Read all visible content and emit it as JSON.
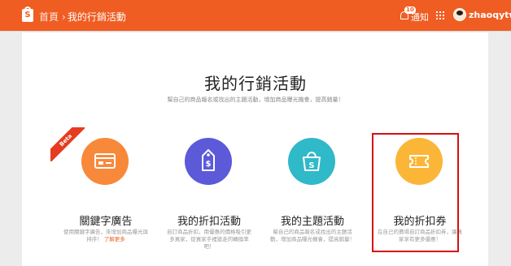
{
  "header": {
    "logo_letter": "S",
    "breadcrumb_home": "首頁",
    "breadcrumb_sep": "›",
    "breadcrumb_current": "我的行銷活動",
    "notification_count": "10",
    "notification_label": "通知",
    "username": "zhaoqytw",
    "color": "#f05d22"
  },
  "main": {
    "title": "我的行銷活動",
    "subtitle": "幫自己的商品報名或找出的主題活動，增加商品曝光機會，提高銷量！"
  },
  "cards": [
    {
      "title": "關鍵字廣告",
      "desc": "使用關鍵字廣告，來增加商品曝光與排序！",
      "link": "了解更多",
      "badge": "Beta",
      "icon": "keyword-ad-icon"
    },
    {
      "title": "我的折扣活動",
      "desc": "自訂商品折扣，用優惠的價格吸引更多買家，從買家手裡搶走的轉換率吧！",
      "icon": "discount-tag-icon"
    },
    {
      "title": "我的主題活動",
      "desc": "幫自己的商品報名或找出的主題活動，增加商品曝光機會，提高銷量！",
      "icon": "theme-bag-icon"
    },
    {
      "title": "我的折扣券",
      "desc": "在自己的賣場自訂商品折扣券，讓買家享有更多優惠！",
      "icon": "coupon-ticket-icon"
    }
  ]
}
